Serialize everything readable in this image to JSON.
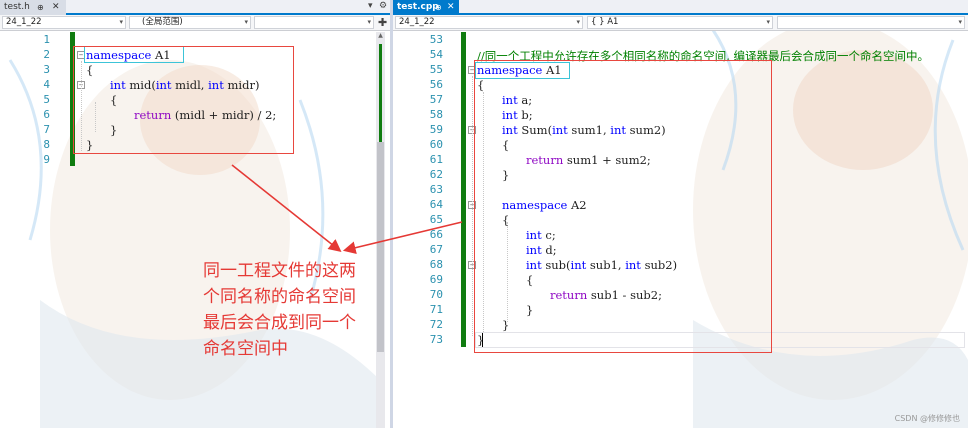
{
  "left_pane": {
    "tab": {
      "title": "test.h",
      "pin": "⊕",
      "close": "✕"
    },
    "strip_buttons": {
      "dropdown": "▾",
      "settings": "⚙"
    },
    "nav": {
      "project": "24_1_22",
      "scope": "(全局范围)",
      "member": ""
    },
    "split_icon": "✚",
    "line_numbers": [
      "1",
      "2",
      "3",
      "4",
      "5",
      "6",
      "7",
      "8",
      "9"
    ],
    "code": {
      "l2_kw": "namespace",
      "l2_name": " A1",
      "l3": "{",
      "l4_kw1": "int",
      "l4_fn": " mid(",
      "l4_kw2": "int",
      "l4_p1": " midl, ",
      "l4_kw3": "int",
      "l4_p2": " midr)",
      "l5": "{",
      "l6_kw": "return",
      "l6_rest": " (midl + midr) / 2;",
      "l7": "}",
      "l8": "}"
    }
  },
  "right_pane": {
    "tab": {
      "title": "test.cpp",
      "pin": "⊕",
      "close": "✕"
    },
    "nav": {
      "project": "24_1_22",
      "scope": "{ } A1",
      "member": ""
    },
    "line_numbers": [
      "53",
      "54",
      "55",
      "56",
      "57",
      "58",
      "59",
      "60",
      "61",
      "62",
      "63",
      "64",
      "65",
      "66",
      "67",
      "68",
      "69",
      "70",
      "71",
      "72",
      "73"
    ],
    "code": {
      "l54": "//同一个工程中允许存在多个相同名称的命名空间, 编译器最后会合成同一个命名空间中。",
      "l55_kw": "namespace",
      "l55_name": " A1",
      "l56": "{",
      "l57_kw": "int",
      "l57_rest": " a;",
      "l58_kw": "int",
      "l58_rest": " b;",
      "l59_kw1": "int",
      "l59_fn": " Sum(",
      "l59_kw2": "int",
      "l59_p1": " sum1, ",
      "l59_kw3": "int",
      "l59_p2": " sum2)",
      "l60": "{",
      "l61_kw": "return",
      "l61_rest": " sum1 + sum2;",
      "l62": "}",
      "l64_kw": "namespace",
      "l64_name": " A2",
      "l65": "{",
      "l66_kw": "int",
      "l66_rest": " c;",
      "l67_kw": "int",
      "l67_rest": " d;",
      "l68_kw1": "int",
      "l68_fn": " sub(",
      "l68_kw2": "int",
      "l68_p1": " sub1, ",
      "l68_kw3": "int",
      "l68_p2": " sub2)",
      "l69": "{",
      "l70_kw": "return",
      "l70_rest": " sub1 - sub2;",
      "l71": "}",
      "l72": "}",
      "l73": "}"
    }
  },
  "annotation": {
    "line1": "同一工程文件的这两",
    "line2": "个同名称的命名空间",
    "line3": "最后会合成到同一个",
    "line4": "命名空间中"
  },
  "watermark": "CSDN @修修修也",
  "colors": {
    "accent": "#007acc",
    "keyword": "#0000ff",
    "comment": "#008000",
    "annotation_red": "#e53935",
    "highlight_cyan": "#3cc4d8",
    "change_bar": "#107c10"
  }
}
